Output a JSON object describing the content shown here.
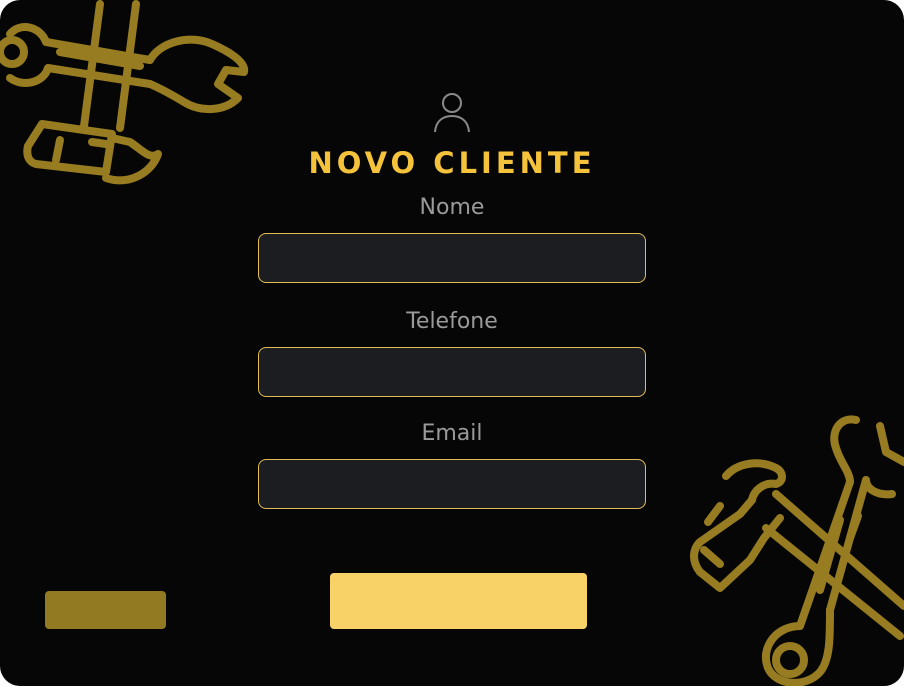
{
  "form": {
    "title": "NOVO CLIENTE",
    "fields": [
      {
        "label": "Nome",
        "value": "",
        "placeholder": ""
      },
      {
        "label": "Telefone",
        "value": "",
        "placeholder": ""
      },
      {
        "label": "Email",
        "value": "",
        "placeholder": ""
      }
    ]
  },
  "buttons": {
    "back_label": "",
    "save_label": ""
  },
  "icons": {
    "avatar": "user-icon",
    "decoration_top_left": "hammer-wrench-icon",
    "decoration_bottom_right": "hammer-wrench-icon"
  },
  "colors": {
    "background": "#060606",
    "accent": "#f5c33b",
    "decoration": "#977c21",
    "input_background": "#1b1d21",
    "input_border": "#e2bd55",
    "label": "#9a9a9a",
    "save_button": "#f8d266",
    "back_button": "#927a22"
  }
}
